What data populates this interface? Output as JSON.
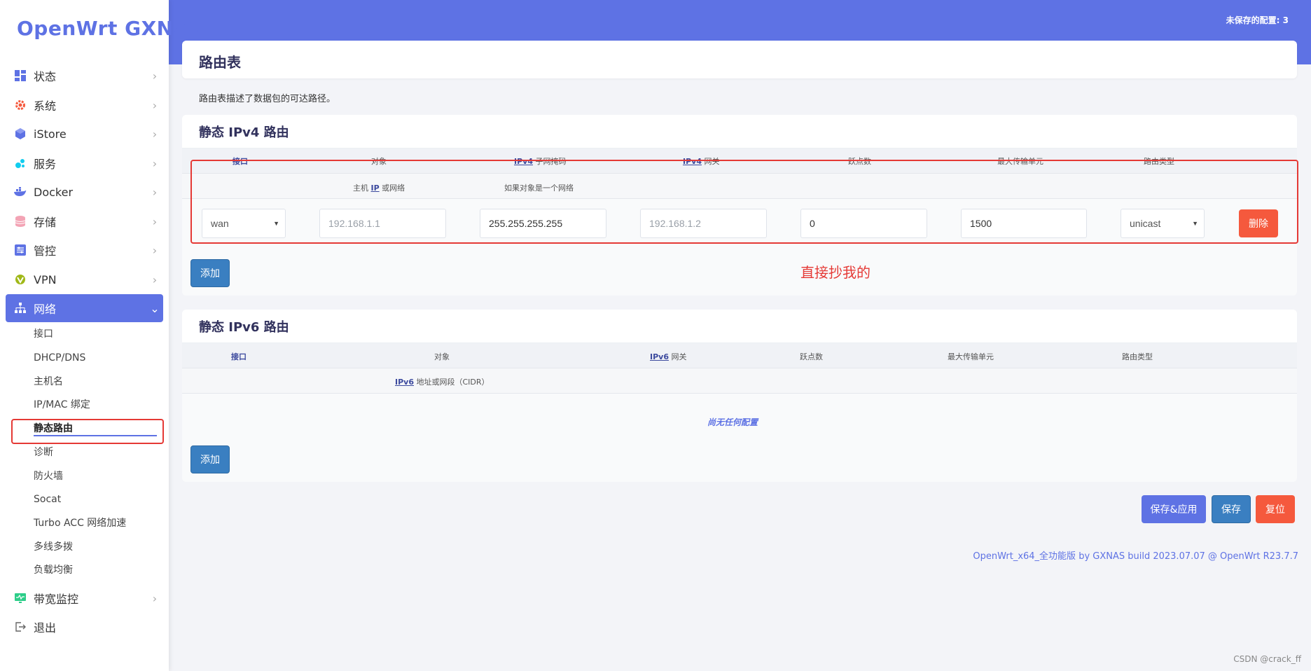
{
  "brand": "OpenWrt GXNAS",
  "header": {
    "unsaved": "未保存的配置: 3"
  },
  "sidebar": {
    "menu": [
      {
        "label": "状态",
        "icon": "dashboard-icon"
      },
      {
        "label": "系统",
        "icon": "gear-icon"
      },
      {
        "label": "iStore",
        "icon": "cube-icon"
      },
      {
        "label": "服务",
        "icon": "puzzle-icon"
      },
      {
        "label": "Docker",
        "icon": "docker-icon"
      },
      {
        "label": "存储",
        "icon": "database-icon"
      },
      {
        "label": "管控",
        "icon": "sliders-icon"
      },
      {
        "label": "VPN",
        "icon": "vpn-icon"
      },
      {
        "label": "网络",
        "icon": "network-icon"
      }
    ],
    "network_sub": [
      "接口",
      "DHCP/DNS",
      "主机名",
      "IP/MAC 绑定",
      "静态路由",
      "诊断",
      "防火墙",
      "Socat",
      "Turbo ACC 网络加速",
      "多线多拨",
      "负载均衡"
    ],
    "bottom": [
      {
        "label": "带宽监控",
        "icon": "monitor-icon"
      },
      {
        "label": "退出",
        "icon": "logout-icon"
      }
    ]
  },
  "page": {
    "title": "路由表",
    "description": "路由表描述了数据包的可达路径。"
  },
  "ipv4": {
    "title": "静态 IPv4 路由",
    "columns": [
      "接口",
      "对象",
      "IPv4 子网掩码",
      "IPv4 网关",
      "跃点数",
      "最大传输单元",
      "路由类型"
    ],
    "col_prefix_ipv4": "IPv4",
    "col_netmask_rest": " 子网掩码",
    "col_gateway_rest": " 网关",
    "sub_target_pre": "主机 ",
    "sub_target_ip": "IP",
    "sub_target_post": " 或网络",
    "sub_netmask": "如果对象是一个网络",
    "row": {
      "interface": "wan",
      "target": "192.168.1.1",
      "netmask": "255.255.255.255",
      "gateway": "192.168.1.2",
      "metric": "0",
      "mtu": "1500",
      "type": "unicast"
    },
    "delete": "删除",
    "add": "添加"
  },
  "annotation": "直接抄我的",
  "ipv6": {
    "title": "静态 IPv6 路由",
    "col_interface": "接口",
    "col_target": "对象",
    "col_gateway_prefix": "IPv6",
    "col_gateway_rest": " 网关",
    "col_metric": "跃点数",
    "col_mtu": "最大传输单元",
    "col_type": "路由类型",
    "sub_target_prefix": "IPv6",
    "sub_target_rest": " 地址或网段（CIDR）",
    "empty": "尚无任何配置",
    "add": "添加"
  },
  "actions": {
    "save_apply": "保存&应用",
    "save": "保存",
    "reset": "复位"
  },
  "footer": "OpenWrt_x64_全功能版 by GXNAS build 2023.07.07 @ OpenWrt R23.7.7",
  "watermark": "CSDN @crack_ff",
  "colors": {
    "accent": "#5e72e4",
    "danger": "#f5593d",
    "primary_btn": "#3a7fc1",
    "annotation": "#e53935"
  }
}
